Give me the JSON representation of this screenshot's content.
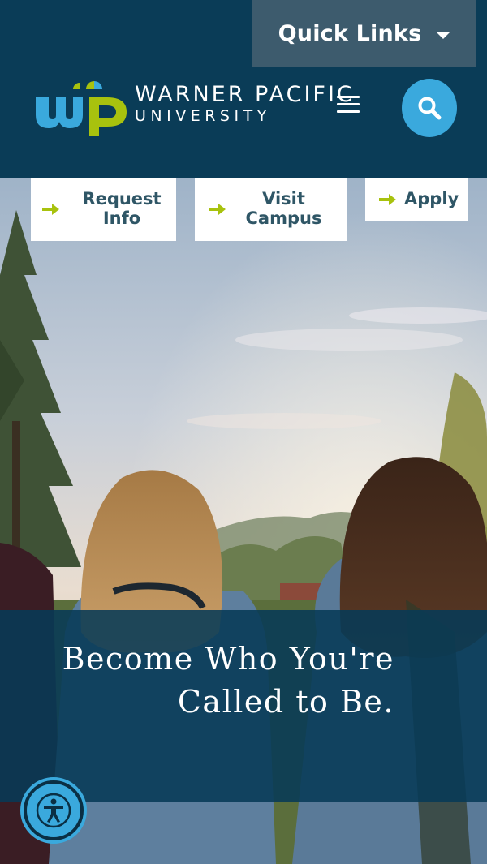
{
  "header": {
    "quick_links_label": "Quick Links",
    "logo_mark": "wp",
    "wordmark_line1": "WARNER PACIFIC",
    "wordmark_line2": "UNIVERSITY",
    "menu_icon": "hamburger-menu-icon",
    "search_icon": "search-icon"
  },
  "cta": {
    "request_info": "Request Info",
    "visit_campus": "Visit Campus",
    "apply": "Apply"
  },
  "hero": {
    "headline": "Become Who You're Called to Be."
  },
  "accessibility": {
    "icon": "accessibility-person-icon"
  },
  "colors": {
    "header_bg": "#0a3c57",
    "quick_links_bg": "#3d5b6d",
    "accent_blue": "#3aa9dd",
    "accent_green": "#a8c20e",
    "cta_text": "#2f5666"
  }
}
